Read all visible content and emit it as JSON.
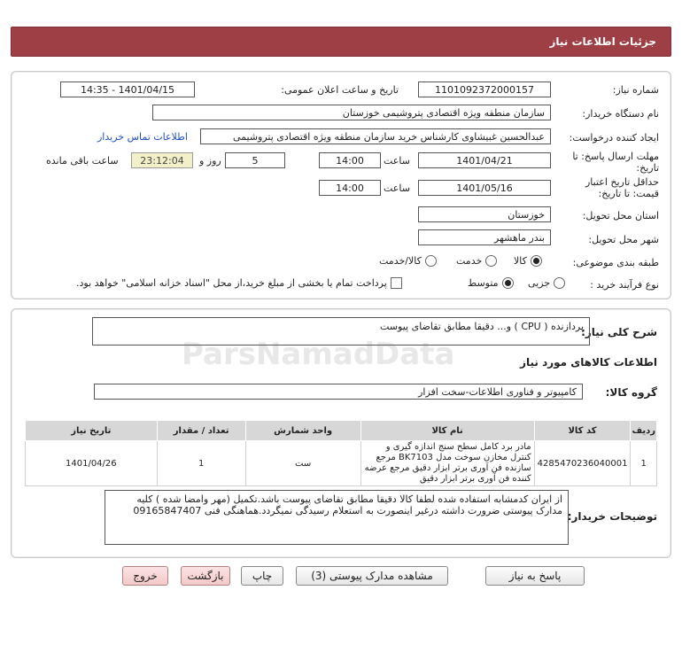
{
  "header": {
    "title": "جزئیات اطلاعات نیاز"
  },
  "form": {
    "need_number": {
      "label": "شماره نیاز:",
      "value": "1101092372000157"
    },
    "announce_datetime": {
      "label": "تاریخ و ساعت اعلان عمومی:",
      "value": "1401/04/15 - 14:35"
    },
    "buyer_org": {
      "label": "نام دستگاه خریدار:",
      "value": "سازمان منطقه ویژه اقتصادی پتروشیمی خوزستان"
    },
    "creator": {
      "label": "ایجاد کننده درخواست:",
      "value": "عبدالحسین غبیشاوی کارشناس خرید سازمان منطقه ویژه اقتصادی پتروشیمی",
      "contact_link": "اطلاعات تماس خریدار"
    },
    "reply_deadline": {
      "label_line1": "مهلت ارسال پاسخ: تا",
      "label_line2": "تاریخ:",
      "date": "1401/04/21",
      "time_label": "ساعت",
      "time": "14:00",
      "days": "5",
      "days_label": "روز و",
      "remaining": "23:12:04",
      "remaining_label": "ساعت باقی مانده"
    },
    "price_validity": {
      "label_line1": "حداقل تاریخ اعتبار",
      "label_line2": "قیمت: تا تاریخ:",
      "date": "1401/05/16",
      "time_label": "ساعت",
      "time": "14:00"
    },
    "province": {
      "label": "استان محل تحویل:",
      "value": "خوزستان"
    },
    "city": {
      "label": "شهر محل تحویل:",
      "value": "بندر ماهشهر"
    },
    "category": {
      "label": "طبقه بندی موضوعی:",
      "options": [
        "کالا",
        "خدمت",
        "کالا/خدمت"
      ],
      "selected": "کالا"
    },
    "purchase_process": {
      "label": "نوع فرآیند خرید :",
      "options": [
        "جزیی",
        "متوسط"
      ],
      "selected": "متوسط",
      "payment_note": "پرداخت تمام یا بخشی از مبلغ خرید،از محل \"اسناد خزانه اسلامی\" خواهد بود."
    }
  },
  "summary": {
    "label": "شرح کلی نیاز:",
    "value": "پردازنده ( CPU ) و... دقیقا مطابق تقاضای پیوست",
    "goods_title": "اطلاعات کالاهای مورد نیاز",
    "group_label": "گروه کالا:",
    "group_value": "کامپیوتر و فناوری اطلاعات-سخت افزار"
  },
  "table": {
    "headers": [
      "ردیف",
      "کد کالا",
      "نام کالا",
      "واحد شمارش",
      "تعداد / مقدار",
      "تاریخ نیاز"
    ],
    "rows": [
      {
        "index": "1",
        "code": "4285470236040001",
        "name": "مادر برد کامل سطح سنج اندازه گیری و کنترل مخازن سوخت مدل BK7103 مرجع سازنده فن آوری برتر ابزار دقیق مرجع عرضه کننده فن آوری برتر ابزار دقیق",
        "unit": "ست",
        "qty": "1",
        "date": "1401/04/26"
      }
    ]
  },
  "buyer_notes": {
    "label": "توضیحات خریدار:",
    "text": "از ایران کدمشابه استفاده شده لطفا کالا دقیقا مطابق تقاضای پیوست باشد.تکمیل (مهر وامضا شده ) کلیه مدارک پیوستی ضرورت داشته درغیر اینصورت به استعلام رسیدگی نمیگردد.هماهنگی فنی 09165847407"
  },
  "buttons": {
    "reply": "پاسخ به نیاز",
    "attachments": "مشاهده مدارک پیوستی (3)",
    "print": "چاپ",
    "back": "بازگشت",
    "exit": "خروج"
  },
  "watermark": {
    "brand": "ParsNamadData"
  }
}
